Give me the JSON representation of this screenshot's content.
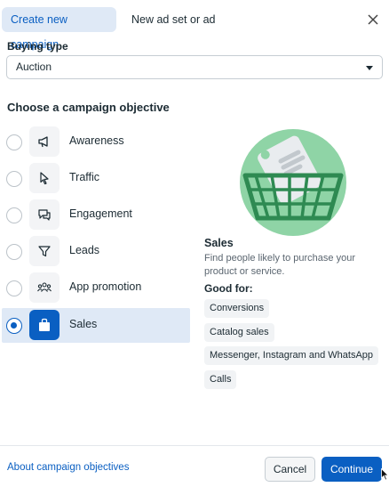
{
  "tabs": [
    {
      "label": "Create new campaign",
      "active": true
    },
    {
      "label": "New ad set or ad",
      "active": false
    }
  ],
  "buying_type": {
    "label": "Buying type",
    "selected": "Auction"
  },
  "objectives_title": "Choose a campaign objective",
  "objectives": [
    {
      "label": "Awareness",
      "icon": "megaphone-icon",
      "selected": false
    },
    {
      "label": "Traffic",
      "icon": "cursor-icon",
      "selected": false
    },
    {
      "label": "Engagement",
      "icon": "chat-bubbles-icon",
      "selected": false
    },
    {
      "label": "Leads",
      "icon": "funnel-icon",
      "selected": false
    },
    {
      "label": "App promotion",
      "icon": "people-group-icon",
      "selected": false
    },
    {
      "label": "Sales",
      "icon": "shopping-bag-icon",
      "selected": true
    }
  ],
  "detail": {
    "title": "Sales",
    "description": "Find people likely to purchase your product or service.",
    "good_for_label": "Good for:",
    "good_for": [
      "Conversions",
      "Catalog sales",
      "Messenger, Instagram and WhatsApp",
      "Calls"
    ]
  },
  "footer": {
    "link": "About campaign objectives",
    "cancel": "Cancel",
    "continue": "Continue"
  },
  "colors": {
    "accent": "#0a5fc2",
    "selected_bg": "#dfe9f6",
    "illustration_green": "#66c28a"
  }
}
